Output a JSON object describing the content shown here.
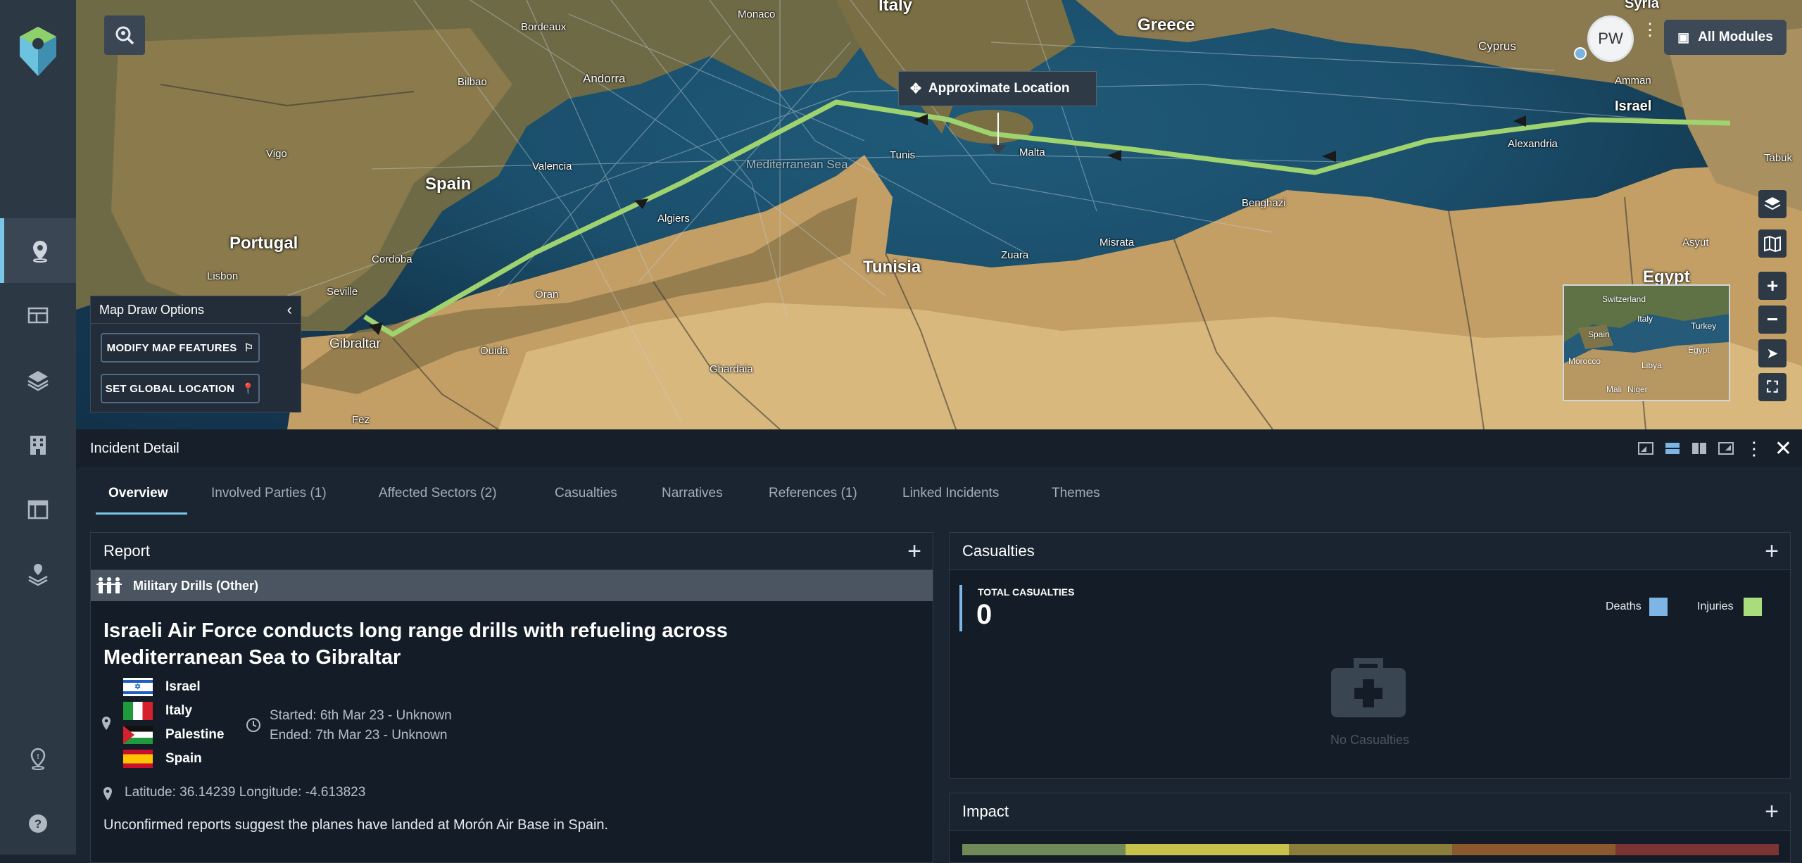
{
  "sidebar": {
    "items": [
      {
        "name": "map-pin-icon",
        "active": true
      },
      {
        "name": "table-icon"
      },
      {
        "name": "layers-icon"
      },
      {
        "name": "building-icon"
      },
      {
        "name": "layout-icon"
      },
      {
        "name": "stacked-pin-icon"
      },
      {
        "name": "location-marker-icon"
      },
      {
        "name": "help-icon"
      }
    ]
  },
  "map": {
    "labels": {
      "countries": [
        "Italy",
        "Greece",
        "Syria",
        "Spain",
        "Portugal",
        "Tunisia",
        "Egypt",
        "Israel",
        "Cyprus"
      ],
      "cities": [
        "Bordeaux",
        "Monaco",
        "Andorra",
        "Bilbao",
        "Vigo",
        "Valencia",
        "Cordoba",
        "Lisbon",
        "Seville",
        "Gibraltar",
        "Ouida",
        "Fez",
        "Algiers",
        "Oran",
        "Tunis",
        "Malta",
        "Zuara",
        "Misrata",
        "Benghazi",
        "Alexandria",
        "Amman",
        "Ghardaia",
        "Asyut",
        "Tabuk",
        "Mediterranean Sea"
      ]
    },
    "approx_location_label": "Approximate Location",
    "draw_options": {
      "title": "Map Draw Options",
      "modify_label": "MODIFY MAP FEATURES",
      "set_location_label": "SET GLOBAL LOCATION"
    },
    "avatar_initials": "PW",
    "modules_label": "All Modules",
    "minimap_labels": [
      "Switzerland",
      "Italy",
      "Spain",
      "Morocco",
      "Libya",
      "Mali",
      "Niger",
      "Turkey",
      "Egypt"
    ],
    "route_color": "#9fd36f"
  },
  "panel": {
    "title": "Incident Detail",
    "tabs": [
      "Overview",
      "Involved Parties (1)",
      "Affected Sectors (2)",
      "Casualties",
      "Narratives",
      "References (1)",
      "Linked Incidents",
      "Themes"
    ]
  },
  "report": {
    "title": "Report",
    "category": "Military Drills (Other)",
    "headline_line1": "Israeli Air Force conducts long range drills with refueling across",
    "headline_line2": "Mediterranean Sea to Gibraltar",
    "countries": [
      "Israel",
      "Italy",
      "Palestine",
      "Spain"
    ],
    "started": "Started: 6th Mar 23 - Unknown",
    "ended": "Ended: 7th Mar 23 - Unknown",
    "coordinates": "Latitude: 36.14239 Longitude: -4.613823",
    "summary": "Unconfirmed reports suggest the planes have landed at Morón Air Base in Spain."
  },
  "casualties": {
    "title": "Casualties",
    "total_label": "TOTAL CASUALTIES",
    "total_value": "0",
    "legend": [
      {
        "label": "Deaths",
        "color": "#7db6e6"
      },
      {
        "label": "Injuries",
        "color": "#a8dc7c"
      }
    ],
    "empty_label": "No Casualties"
  },
  "impact": {
    "title": "Impact",
    "scale_colors": [
      "#6f8a57",
      "#c8c24c",
      "#8b7d3a",
      "#8a5a2e",
      "#7a3434"
    ]
  }
}
